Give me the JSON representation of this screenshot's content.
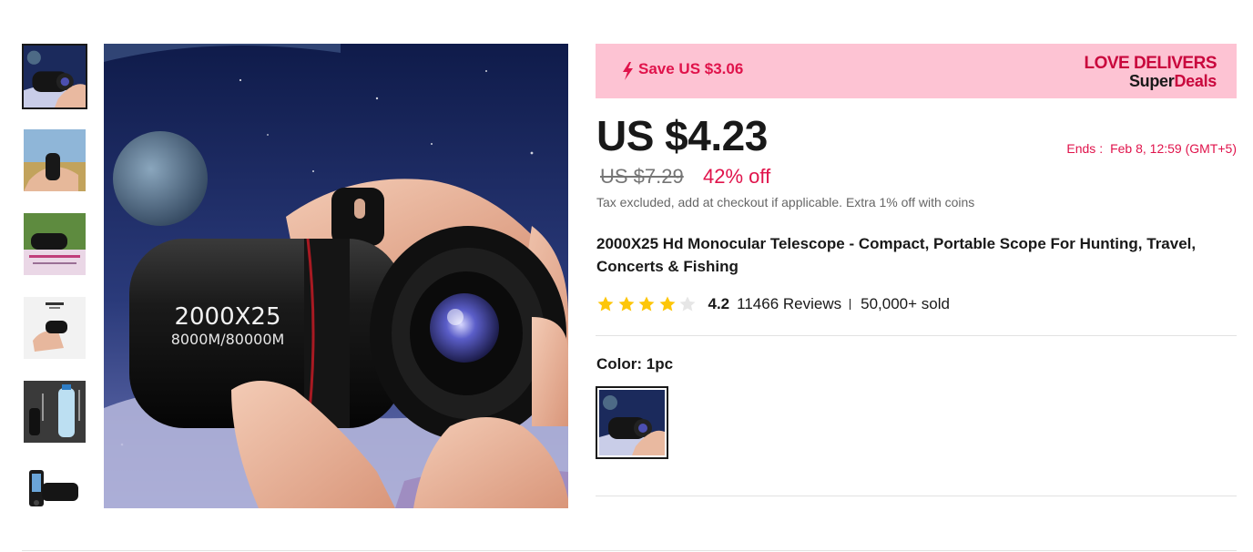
{
  "gallery": {
    "thumbnails": [
      {
        "name": "thumb-monocular-space"
      },
      {
        "name": "thumb-monocular-in-hand"
      },
      {
        "name": "thumb-outdoor-scene"
      },
      {
        "name": "thumb-monocular-white-background"
      },
      {
        "name": "thumb-size-comparison-bottle"
      },
      {
        "name": "thumb-phone-adapter"
      }
    ],
    "main_image": {
      "printed_text_line1": "2000X25",
      "printed_text_line2": "8000M/80000M"
    }
  },
  "promo": {
    "save_text": "Save US $3.06",
    "brand_line1": "LOVE DELIVERS",
    "brand_line2_part1": "Super",
    "brand_line2_part2": "Deals",
    "background_color": "#fdc3d3",
    "accent_color": "#e0134b"
  },
  "pricing": {
    "current_price": "US $4.23",
    "original_price": "US $7.29",
    "discount": "42% off",
    "ends_label": "Ends :",
    "ends_value": "Feb 8, 12:59 (GMT+5)",
    "tax_note": "Tax excluded, add at checkout if applicable. Extra 1% off with coins"
  },
  "product": {
    "title": "2000X25 Hd Monocular Telescope - Compact, Portable Scope For Hunting, Travel, Concerts & Fishing"
  },
  "rating": {
    "score": "4.2",
    "stars_filled": 4,
    "stars_total": 5,
    "reviews": "11466 Reviews",
    "sold": "50,000+ sold",
    "star_color": "#fdc609"
  },
  "variants": {
    "color_label": "Color: 1pc"
  }
}
